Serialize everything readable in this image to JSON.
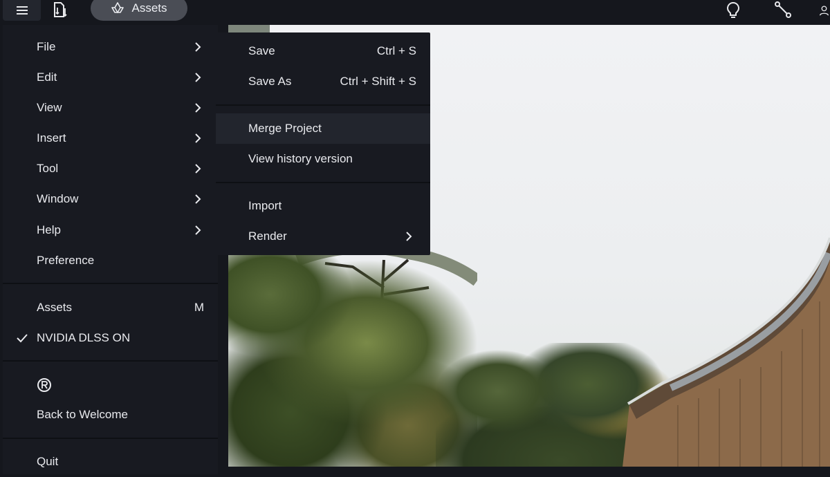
{
  "toolbar": {
    "assets_label": "Assets"
  },
  "main_menu": {
    "items": [
      {
        "label": "File",
        "has_submenu": true
      },
      {
        "label": "Edit",
        "has_submenu": true
      },
      {
        "label": "View",
        "has_submenu": true
      },
      {
        "label": "Insert",
        "has_submenu": true
      },
      {
        "label": "Tool",
        "has_submenu": true
      },
      {
        "label": "Window",
        "has_submenu": true
      },
      {
        "label": "Help",
        "has_submenu": true
      },
      {
        "label": "Preference",
        "has_submenu": false
      }
    ],
    "assets": {
      "label": "Assets",
      "shortcut": "M"
    },
    "dlss": {
      "label": "NVIDIA DLSS ON",
      "checked": true
    },
    "back_to_welcome": {
      "label": "Back to Welcome"
    },
    "quit": {
      "label": "Quit"
    }
  },
  "file_submenu": {
    "items": [
      {
        "label": "Save",
        "shortcut": "Ctrl + S"
      },
      {
        "label": "Save As",
        "shortcut": "Ctrl + Shift + S"
      },
      {
        "label": "Merge Project",
        "highlighted": true
      },
      {
        "label": "View history version"
      },
      {
        "label": "Import"
      },
      {
        "label": "Render",
        "has_submenu": true
      }
    ]
  },
  "colors": {
    "menu_bg": "#181a21",
    "topbar_bg": "#15171d",
    "assets_pill": "#4a4d55",
    "text": "#e9eaee"
  },
  "icons": {
    "hamburger": "menu-icon",
    "document": "document-swap-icon",
    "assets": "assets-icon",
    "lightbulb": "lightbulb-icon",
    "share": "share-icon",
    "check": "check-icon",
    "registered": "registered-icon",
    "chevron": "chevron-right-icon"
  }
}
